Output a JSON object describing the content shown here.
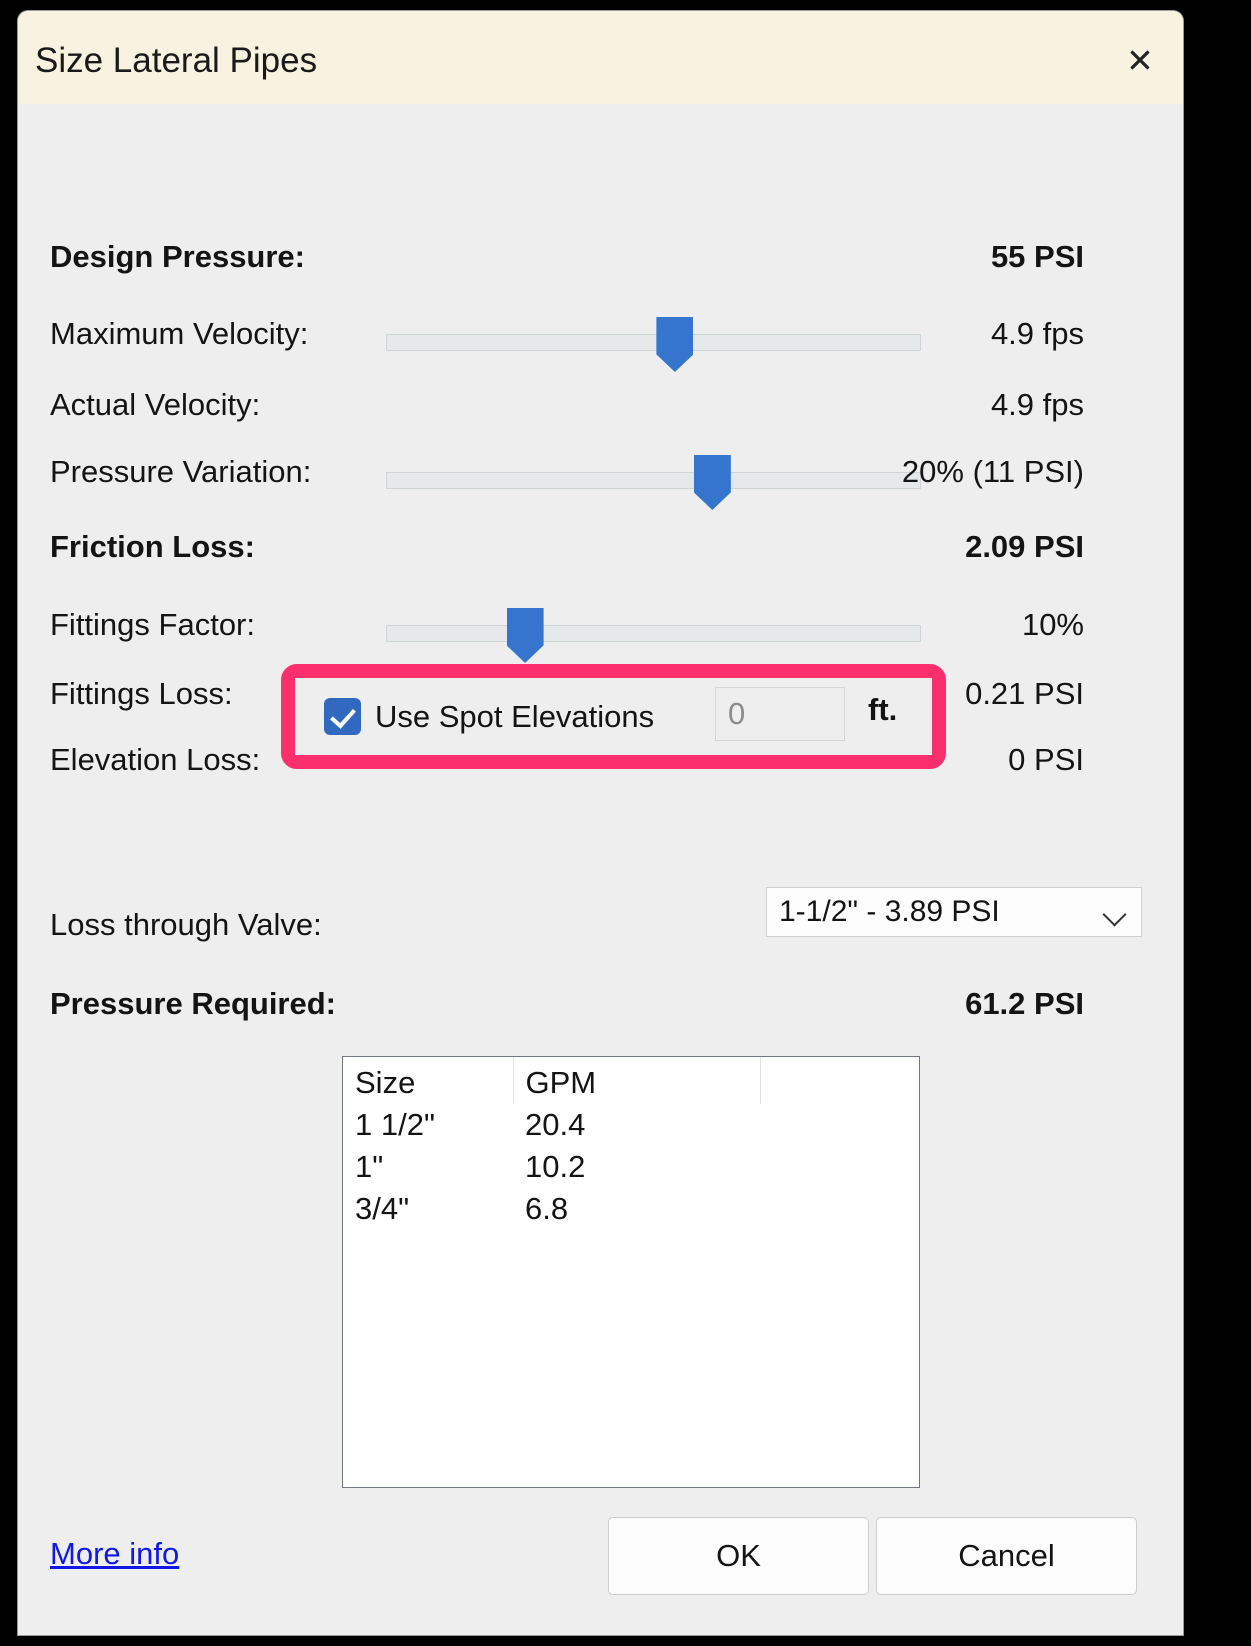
{
  "dialog": {
    "title": "Size Lateral Pipes",
    "close_icon": "close-icon"
  },
  "rows": [
    {
      "label": "Design Pressure:",
      "value": "55  PSI",
      "bold": true
    },
    {
      "label": "Maximum Velocity:",
      "value": "4.9  fps",
      "bold": false
    },
    {
      "label": "Actual Velocity:",
      "value": "4.9  fps",
      "bold": false
    },
    {
      "label": "Pressure Variation:",
      "value": "20%  (11 PSI)",
      "bold": false
    },
    {
      "label": "Friction Loss:",
      "value": "2.09  PSI",
      "bold": true
    },
    {
      "label": "Fittings Factor:",
      "value": "10%",
      "bold": false
    },
    {
      "label": "Fittings Loss:",
      "value": "0.21  PSI",
      "bold": false
    },
    {
      "label": "Elevation Loss:",
      "value": "0  PSI",
      "bold": false
    }
  ],
  "sliders": {
    "max_velocity_percent": 54,
    "pressure_variation_percent": 61,
    "fittings_factor_percent": 26
  },
  "spot_elevations": {
    "label": "Use Spot Elevations",
    "checked": true,
    "value": "0",
    "unit": "ft."
  },
  "valve": {
    "label": "Loss through Valve:",
    "selected": "1-1/2\" - 3.89 PSI",
    "chevron_icon": "chevron-down-icon"
  },
  "pressure_required": {
    "label": "Pressure Required:",
    "value": "61.2  PSI"
  },
  "table": {
    "headers": [
      "Size",
      "GPM",
      ""
    ],
    "rows": [
      [
        "1 1/2\"",
        "20.4",
        ""
      ],
      [
        "1\"",
        "10.2",
        ""
      ],
      [
        "3/4\"",
        "6.8",
        ""
      ]
    ]
  },
  "footer": {
    "more_info": "More info",
    "ok": "OK",
    "cancel": "Cancel"
  },
  "colors": {
    "titlebar": "#f7f3e0",
    "accent_blue": "#3575cd",
    "highlight_pink": "#fb2e6e",
    "link_blue": "#1018e8"
  }
}
